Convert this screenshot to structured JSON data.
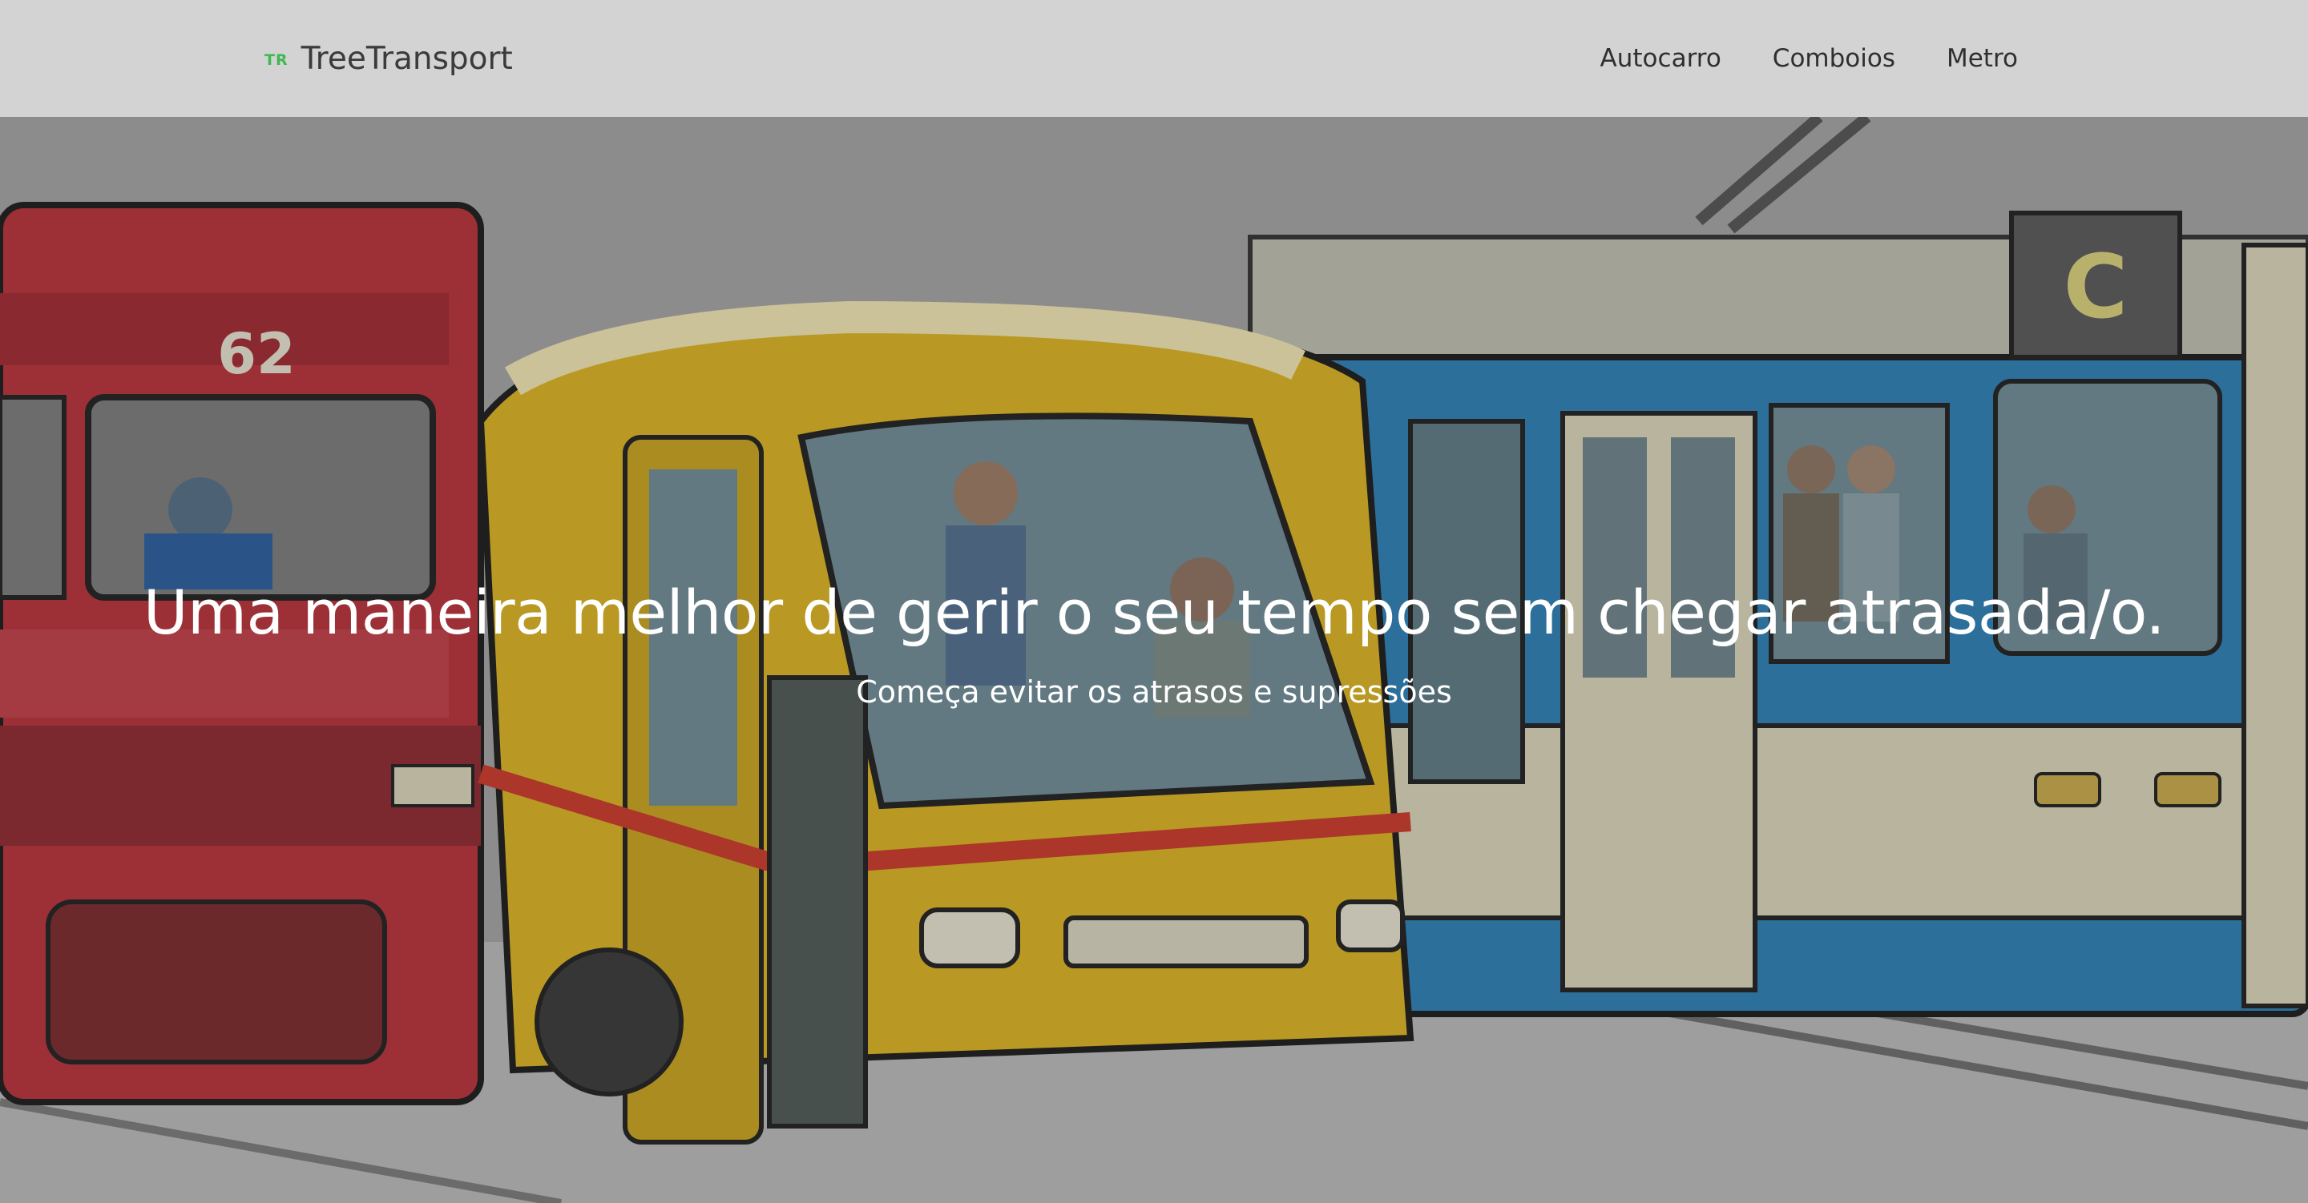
{
  "navbar": {
    "brand_mark": "TR",
    "brand_name": "TreeTransport",
    "links": [
      {
        "label": "Autocarro"
      },
      {
        "label": "Comboios"
      },
      {
        "label": "Metro"
      }
    ]
  },
  "hero": {
    "title": "Uma maneira melhor de gerir o seu tempo sem chegar atrasada/o.",
    "subtitle": "Começa evitar os atrasos e supressões",
    "image_subject": "illustration-train-bus-tram",
    "tram_route_sign": "C",
    "train_number": "62"
  },
  "colors": {
    "navbar_bg": "#d3d3d3",
    "brand_accent": "#3fb950",
    "train_red": "#b8323a",
    "bus_yellow": "#d9b323",
    "tram_blue": "#2f7fb5",
    "hero_text": "#ffffff"
  }
}
